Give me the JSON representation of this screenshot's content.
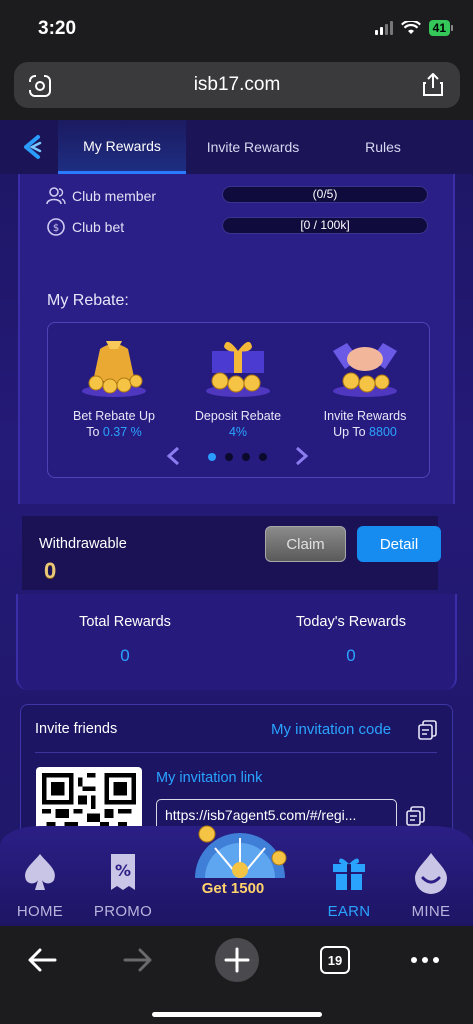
{
  "status_bar": {
    "time": "3:20",
    "battery": "41"
  },
  "browser": {
    "url": "isb17.com",
    "tab_count": "19"
  },
  "tabs": [
    {
      "label": "My Rewards",
      "active": true
    },
    {
      "label": "Invite Rewards",
      "active": false
    },
    {
      "label": "Rules",
      "active": false
    }
  ],
  "club": {
    "member_label": "Club member",
    "member_value": "(0/5)",
    "bet_label": "Club bet",
    "bet_value": "[0 / 100k]"
  },
  "rebate": {
    "title": "My Rebate:",
    "items": [
      {
        "line1": "Bet Rebate Up",
        "line2_prefix": "To ",
        "value": "0.37 %",
        "icon": "coin-bag-icon"
      },
      {
        "line1": "Deposit Rebate",
        "line2_prefix": "",
        "value": "4%",
        "icon": "gift-coins-icon"
      },
      {
        "line1": "Invite Rewards",
        "line2_prefix": "Up To ",
        "value": "8800",
        "icon": "handshake-coins-icon"
      }
    ],
    "page_count": 4,
    "current_page": 1
  },
  "withdraw": {
    "label": "Withdrawable",
    "value": "0",
    "claim_label": "Claim",
    "detail_label": "Detail"
  },
  "totals": {
    "total_label": "Total Rewards",
    "total_value": "0",
    "today_label": "Today's Rewards",
    "today_value": "0"
  },
  "invite": {
    "title": "Invite friends",
    "code_link": "My invitation code",
    "link_label": "My invitation link",
    "link_value": "https://isb7agent5.com/#/regi..."
  },
  "bottom_nav": {
    "home": "HOME",
    "promo": "PROMO",
    "center": "Get 1500",
    "earn": "EARN",
    "mine": "MINE"
  },
  "colors": {
    "accent": "#2aa3ff",
    "background": "#241a78",
    "gold": "#ffd36b"
  }
}
